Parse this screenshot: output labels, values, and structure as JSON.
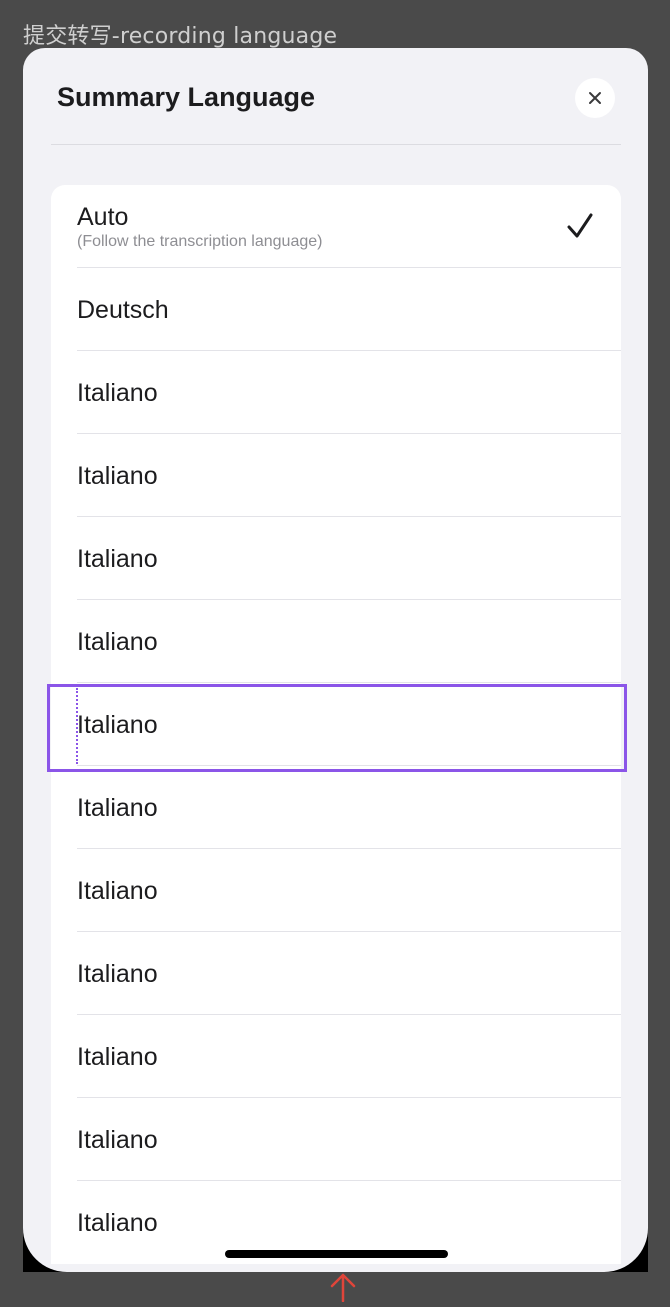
{
  "frame": {
    "title": "提交转写-recording language"
  },
  "sheet": {
    "title": "Summary Language",
    "close_icon": "close-icon"
  },
  "languages": [
    {
      "label": "Auto",
      "sub": "(Follow the transcription language)",
      "selected": true
    },
    {
      "label": "Deutsch",
      "selected": false
    },
    {
      "label": "Italiano",
      "selected": false
    },
    {
      "label": "Italiano",
      "selected": false
    },
    {
      "label": "Italiano",
      "selected": false
    },
    {
      "label": "Italiano",
      "selected": false
    },
    {
      "label": "Italiano",
      "selected": false,
      "focused": true
    },
    {
      "label": "Italiano",
      "selected": false
    },
    {
      "label": "Italiano",
      "selected": false
    },
    {
      "label": "Italiano",
      "selected": false
    },
    {
      "label": "Italiano",
      "selected": false
    },
    {
      "label": "Italiano",
      "selected": false
    },
    {
      "label": "Italiano",
      "selected": false
    }
  ],
  "colors": {
    "background": "#4a4a4a",
    "sheet": "#f2f2f6",
    "list": "#ffffff",
    "focus_outline": "#8b55e8",
    "arrow": "#e0453a"
  }
}
